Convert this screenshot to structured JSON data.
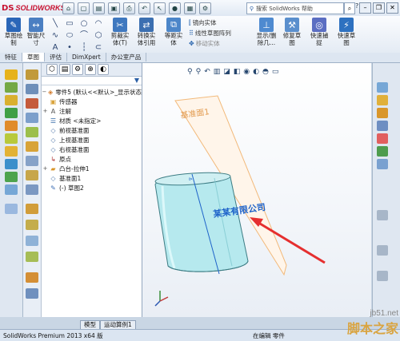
{
  "app": {
    "logo_text": "SOLIDWORKS",
    "logo_mark": "DS"
  },
  "search": {
    "placeholder": "搜索 SolidWorks 帮助",
    "help": "?"
  },
  "ribbon": {
    "sketch": "草图绘\n制",
    "smart_dim": "智能尺\n寸",
    "trim": "剪裁实\n体(T)",
    "convert": "转换实\n体引用",
    "offset": "等距实\n体",
    "mirror": "镜向实体",
    "linear_pattern": "线性草图阵列",
    "move": "移动实体",
    "show_delete": "显示/删\n除几...",
    "repair": "修复草\n图",
    "quick_snap": "快速捕\n捉",
    "quick_sketch": "快速草\n图"
  },
  "tabs": [
    "特征",
    "草图",
    "评估",
    "DimXpert",
    "办公室产品"
  ],
  "tree": [
    "零件5 (默认<<默认>_显示状态",
    "传感器",
    "注解",
    "材质 <未指定>",
    "前视基准面",
    "上视基准面",
    "右视基准面",
    "原点",
    "凸台-拉伸1",
    "基准面1",
    "(-) 草图2"
  ],
  "canvas": {
    "plane_label": "基准面1",
    "sketch_text": "某某有限公司"
  },
  "bottom_tabs": [
    "模型",
    "运动算例1"
  ],
  "status": {
    "left": "SolidWorks Premium 2013 x64 版",
    "right": "在编辑 零件"
  },
  "watermark": {
    "line1": "jb51.net",
    "line2": "脚本之家"
  },
  "colors": {
    "accent": "#c8102e",
    "model": "#b6e9ee",
    "plane": "#f2b97a",
    "arrow": "#e52f2f",
    "sketch_text": "#1d62c9"
  },
  "icons": {
    "origin": "origin-triad-icon",
    "search": "search-icon"
  }
}
